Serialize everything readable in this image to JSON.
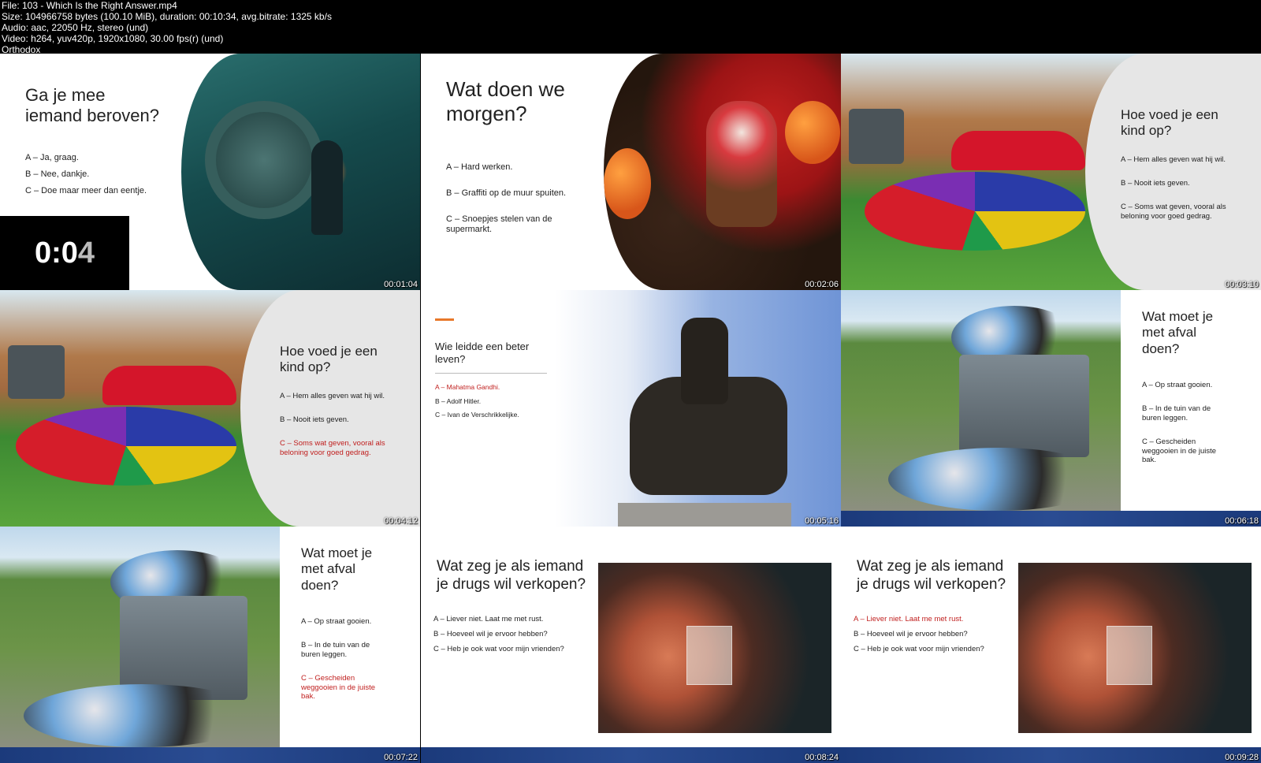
{
  "header": {
    "lines": [
      "File: 103 - Which Is the Right Answer.mp4",
      "Size: 104966758 bytes (100.10 MiB), duration: 00:10:34, avg.bitrate: 1325 kb/s",
      "Audio: aac, 22050 Hz, stereo (und)",
      "Video: h264, yuv420p, 1920x1080, 30.00 fps(r) (und)",
      "Orthodox"
    ]
  },
  "frames": [
    {
      "title": "Ga je mee\niemand beroven?",
      "options": [
        "A – Ja, graag.",
        "B – Nee, dankje.",
        "C – Doe maar meer dan eentje."
      ],
      "timer_main": "0:0",
      "timer_dim": "4",
      "timestamp": "00:01:04"
    },
    {
      "title": "Wat doen we\nmorgen?",
      "options": [
        "A – Hard werken.",
        "B – Graffiti op de muur spuiten.",
        "C – Snoepjes stelen van de\nsupermarkt."
      ],
      "timestamp": "00:02:06"
    },
    {
      "title": "Hoe voed je een\nkind op?",
      "options": [
        "A – Hem alles geven wat hij wil.",
        "B – Nooit iets geven.",
        "C – Soms wat geven, vooral als\nbeloning voor goed gedrag."
      ],
      "timestamp": "00:03:10"
    },
    {
      "title": "Hoe voed je een\nkind op?",
      "options": [
        "A – Hem alles geven wat hij wil.",
        "B – Nooit iets geven.",
        "C – Soms wat geven, vooral als\nbeloning voor goed gedrag."
      ],
      "correct_index": 2,
      "timestamp": "00:04:12"
    },
    {
      "title": "Wie leidde een beter\nleven?",
      "options": [
        "A – Mahatma Gandhi.",
        "B – Adolf Hitler.",
        "C – Ivan de Verschrikkelijke."
      ],
      "correct_index": 0,
      "timestamp": "00:05:16"
    },
    {
      "title": "Wat moet je\nmet afval\ndoen?",
      "options": [
        "A – Op straat gooien.",
        "B – In de tuin van de\nburen leggen.",
        "C – Gescheiden\nweggooien in de juiste\nbak."
      ],
      "timestamp": "00:06:18"
    },
    {
      "title": "Wat moet je\nmet afval\ndoen?",
      "options": [
        "A – Op straat gooien.",
        "B – In de tuin van de\nburen leggen.",
        "C – Gescheiden\nweggooien in de juiste\nbak."
      ],
      "correct_index": 2,
      "timestamp": "00:07:22"
    },
    {
      "title": "Wat zeg je als iemand\nje drugs wil verkopen?",
      "options": [
        "A – Liever niet. Laat me met rust.",
        "B – Hoeveel wil je ervoor hebben?",
        "C – Heb je ook wat voor mijn vrienden?"
      ],
      "timestamp": "00:08:24"
    },
    {
      "title": "Wat zeg je als iemand\nje drugs wil verkopen?",
      "options": [
        "A – Liever niet. Laat me met rust.",
        "B – Hoeveel wil je ervoor hebben?",
        "C – Heb je ook wat voor mijn vrienden?"
      ],
      "correct_index": 0,
      "timestamp": "00:09:28"
    }
  ],
  "colors": {
    "correct_answer": "#c0201f",
    "accent_orange": "#e8782a",
    "blue_bar": "#1b3a7b"
  }
}
